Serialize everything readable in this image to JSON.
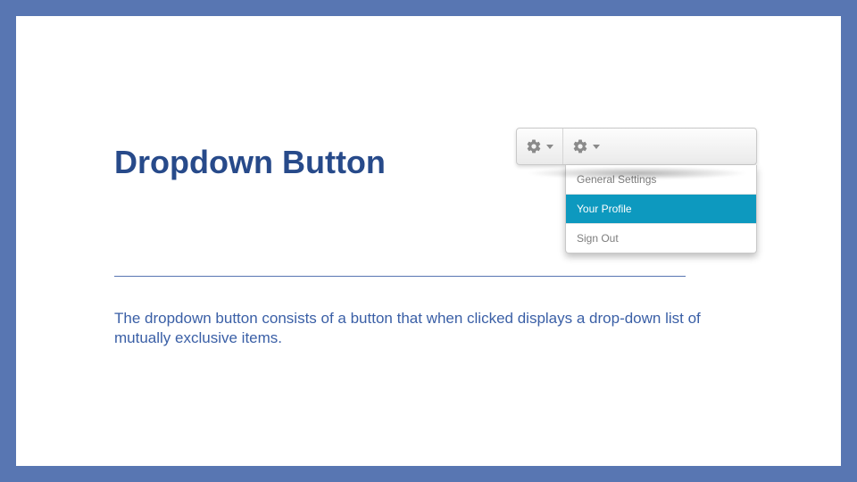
{
  "title": "Dropdown Button",
  "description": "The dropdown button consists of a button that when clicked displays a drop-down list of mutually exclusive items.",
  "menu": {
    "items": [
      {
        "label": "General Settings"
      },
      {
        "label": "Your Profile"
      },
      {
        "label": "Sign Out"
      }
    ]
  }
}
